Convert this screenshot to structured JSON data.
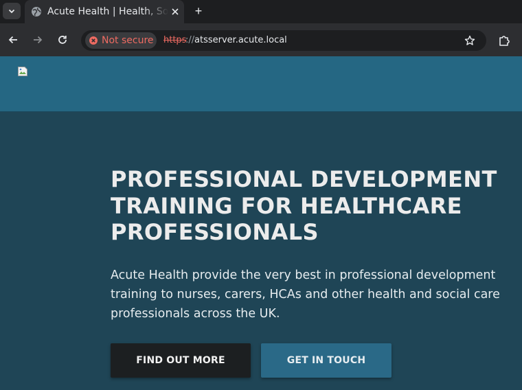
{
  "browser": {
    "tab": {
      "title": "Acute Health | Health, Social Care Training",
      "favicon": "globe-icon",
      "close_icon": "close-icon"
    },
    "tab_list_icon": "chevron-down-icon",
    "new_tab_label": "+",
    "toolbar": {
      "back_icon": "arrow-left-icon",
      "forward_icon": "arrow-right-icon",
      "reload_icon": "reload-icon",
      "security_label": "Not secure",
      "url_scheme": "https",
      "url_separator": "://",
      "url_host": "atsserver.acute.local",
      "bookmark_icon": "star-icon",
      "extensions_icon": "puzzle-icon"
    },
    "colors": {
      "warning": "#ee6b62",
      "frame": "#1d1e20",
      "toolbar": "#2d2e31"
    }
  },
  "site": {
    "logo": "broken-image-icon",
    "hero": {
      "headline": "PROFESSIONAL DEVELOPMENT TRAINING FOR HEALTHCARE PROFESSIONALS",
      "lead": "Acute Health provide the very best in professional development training to nurses, carers, HCAs and other health and social care professionals across the UK.",
      "primary_button": "FIND OUT MORE",
      "secondary_button": "GET IN TOUCH"
    },
    "colors": {
      "header_bg": "#256783",
      "hero_bg": "#1f4556",
      "primary_button_bg": "#1c1f21",
      "secondary_button_bg": "#2a6987"
    }
  }
}
